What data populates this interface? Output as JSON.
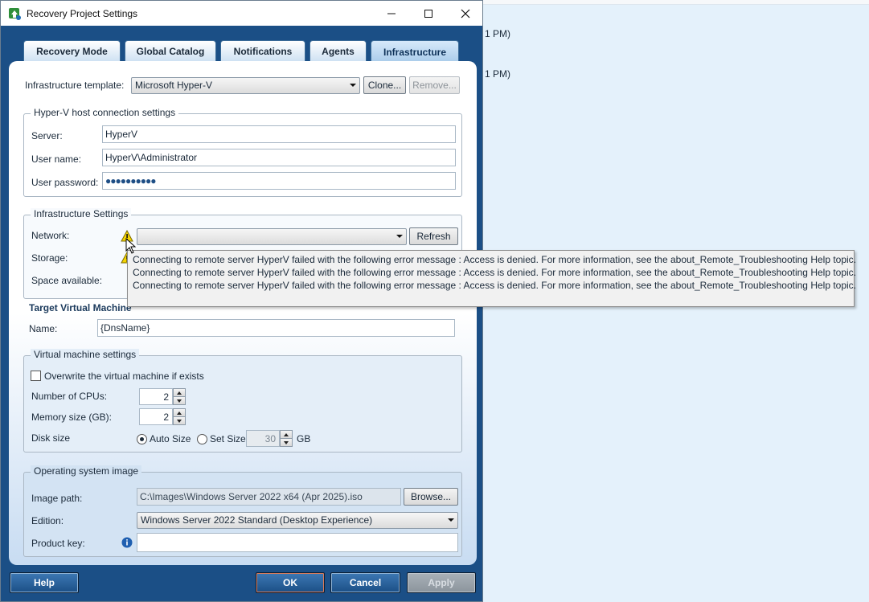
{
  "background_window": {
    "line1": "1 PM)",
    "line2": "1 PM)"
  },
  "dialog": {
    "title": "Recovery Project Settings"
  },
  "tabs": [
    {
      "label": "Recovery Mode"
    },
    {
      "label": "Global Catalog"
    },
    {
      "label": "Notifications"
    },
    {
      "label": "Agents"
    },
    {
      "label": "Infrastructure",
      "active": true
    }
  ],
  "infrastructure": {
    "template_label": "Infrastructure template:",
    "template_value": "Microsoft Hyper-V",
    "clone_label": "Clone...",
    "remove_label": "Remove..."
  },
  "host_connection": {
    "title": "Hyper-V host connection settings",
    "server_label": "Server:",
    "server_value": "HyperV",
    "username_label": "User name:",
    "username_value": "HyperV\\Administrator",
    "password_label": "User password:",
    "password_value": "●●●●●●●●●●"
  },
  "infra_settings": {
    "title": "Infrastructure Settings",
    "network_label": "Network:",
    "network_value": "",
    "refresh_label": "Refresh",
    "storage_label": "Storage:",
    "space_label": "Space available:"
  },
  "tooltip": {
    "lines": [
      "Connecting to remote server HyperV failed with the following error message : Access is denied. For more information, see the about_Remote_Troubleshooting Help topic.",
      "Connecting to remote server HyperV failed with the following error message : Access is denied. For more information, see the about_Remote_Troubleshooting Help topic.",
      "Connecting to remote server HyperV failed with the following error message : Access is denied. For more information, see the about_Remote_Troubleshooting Help topic."
    ]
  },
  "target_vm": {
    "title": "Target Virtual Machine",
    "name_label": "Name:",
    "name_value": "{DnsName}"
  },
  "vm_settings": {
    "title": "Virtual machine settings",
    "overwrite_label": "Overwrite the virtual machine if exists",
    "overwrite_checked": false,
    "cpus_label": "Number of CPUs:",
    "cpus_value": "2",
    "memory_label": "Memory size (GB):",
    "memory_value": "2",
    "disk_label": "Disk size",
    "auto_size_label": "Auto Size",
    "set_size_label": "Set Size",
    "disk_size_value": "30",
    "disk_unit": "GB",
    "selected_disk_option": "Auto Size"
  },
  "os_image": {
    "title": "Operating system image",
    "path_label": "Image path:",
    "path_value": "C:\\Images\\Windows Server 2022 x64 (Apr 2025).iso",
    "browse_label": "Browse...",
    "edition_label": "Edition:",
    "edition_value": "Windows Server 2022 Standard (Desktop Experience)",
    "product_key_label": "Product key:",
    "product_key_value": ""
  },
  "footer": {
    "help_label": "Help",
    "ok_label": "OK",
    "cancel_label": "Cancel",
    "apply_label": "Apply"
  },
  "colors": {
    "dialog_background": "#1b4f86",
    "panel_gradient_end": "#c8dcf2",
    "background_window": "#e4f1fb",
    "button_blue": "#3d78b4",
    "warning_yellow": "#f5d400"
  }
}
